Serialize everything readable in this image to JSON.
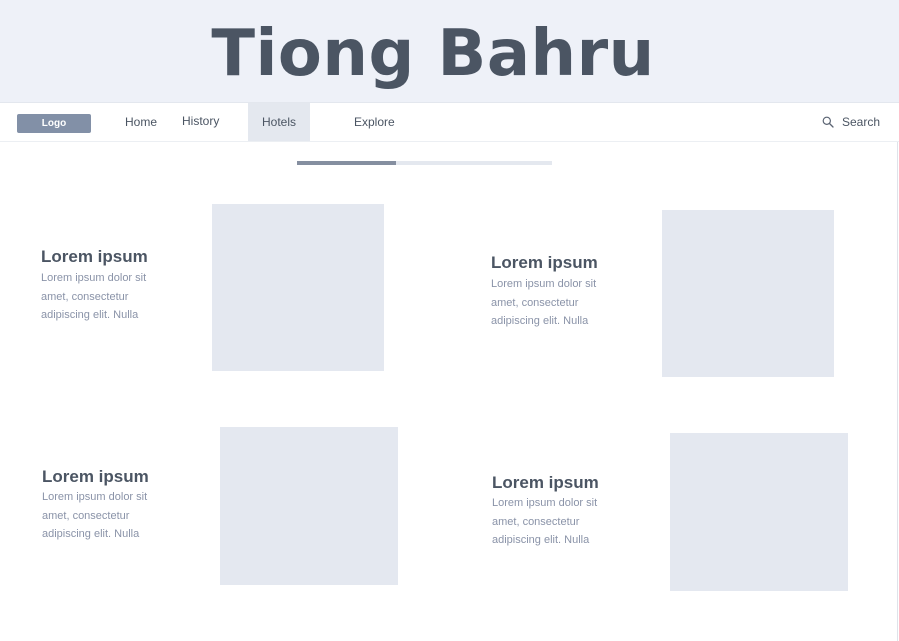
{
  "hero": {
    "title": "Tiong Bahru"
  },
  "nav": {
    "logo": "Logo",
    "items": [
      {
        "label": "Home",
        "active": false
      },
      {
        "label": "History",
        "active": false
      },
      {
        "label": "Hotels",
        "active": true
      },
      {
        "label": "Explore",
        "active": false
      }
    ],
    "search_label": "Search",
    "search_icon": "search-icon"
  },
  "progress": {
    "value": 0.39
  },
  "cards": [
    {
      "title": "Lorem ipsum",
      "text": "Lorem ipsum dolor sit amet, consectetur adipiscing elit. Nulla"
    },
    {
      "title": "Lorem ipsum",
      "text": "Lorem ipsum dolor sit amet, consectetur adipiscing elit. Nulla"
    },
    {
      "title": "Lorem ipsum",
      "text": "Lorem ipsum dolor sit amet, consectetur adipiscing elit. Nulla"
    },
    {
      "title": "Lorem ipsum",
      "text": "Lorem ipsum dolor sit amet, consectetur adipiscing elit. Nulla"
    }
  ],
  "colors": {
    "hero_background": "#eef1f8",
    "logo_background": "#8290a7",
    "active_tab": "#e4e8ef",
    "placeholder_image": "#e4e8f0",
    "progress_fill": "#858fa0"
  }
}
